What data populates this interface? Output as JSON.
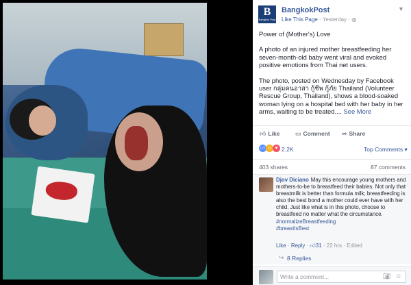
{
  "page": {
    "name": "BangkokPost",
    "like_link": "Like This Page",
    "time": "Yesterday",
    "logo_letter": "B",
    "logo_text": "Bangkok Post"
  },
  "post": {
    "title": "Power of (Mother's) Love",
    "para1": "A photo of an injured mother breastfeeding her seven-month-old baby went viral and evoked positive emotions from Thai net users.",
    "para2": "The photo, posted on Wednesday by Facebook user กลุ่มคนอาสา กู้ชีพ กู้ภัย Thailand (Volunteer Rescue Group, Thailand), shows a blood-soaked woman lying on a hospital bed with her baby in her arms, waiting to be treated....",
    "see_more": "See More"
  },
  "actions": {
    "like": "Like",
    "comment": "Comment",
    "share": "Share"
  },
  "reactions": {
    "count": "2.2K",
    "top_comments": "Top Comments ▾"
  },
  "stats": {
    "shares": "403 shares",
    "comments": "87 comments"
  },
  "comment": {
    "author": "Djov Diciano",
    "text": "May this encourage young mothers and mothers-to-be to breastfeed their babies. Not only that breastmilk is better than formula milk; breastfeeding is also the best bond a mother could ever have with her child. Just like what is in this photo, choose to breastfeed no matter what the circumstance.",
    "tag1": "#normalizeBreastfeeding",
    "tag2": "#breastIsBest",
    "like": "Like",
    "reply": "Reply",
    "likes": "31",
    "age": "22 hrs",
    "edited": "Edited"
  },
  "replies": {
    "label": "8 Replies"
  },
  "write": {
    "placeholder": "Write a comment..."
  },
  "colors": {
    "brand": "#365899",
    "logo_bg": "#1c3e77",
    "like_blue": "#5890ff",
    "love_red": "#f25268",
    "haha_yellow": "#f7b125"
  }
}
